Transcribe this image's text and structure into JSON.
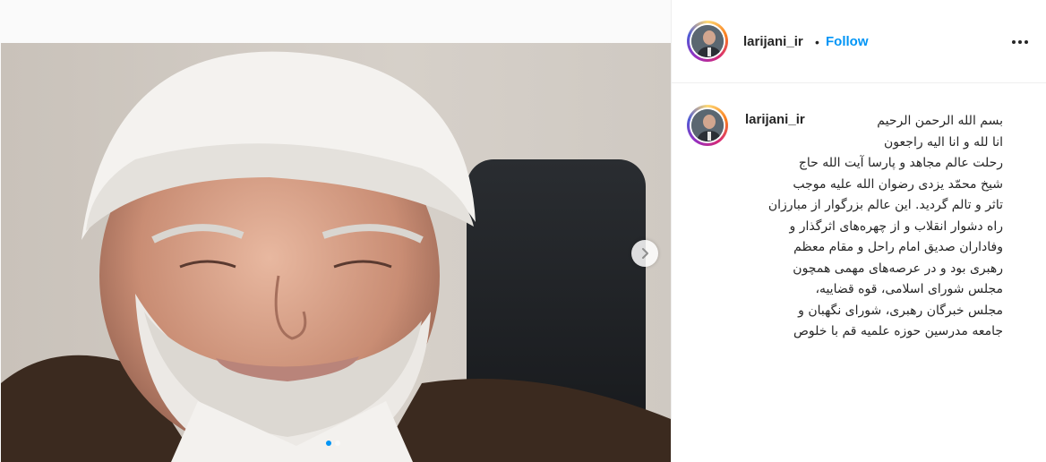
{
  "post": {
    "username": "larijani_ir",
    "separator": "•",
    "follow_label": "Follow",
    "more_icon": "more-horizontal-icon",
    "next_icon": "chevron-right-icon",
    "carousel": {
      "slides": 2,
      "active": 1
    },
    "caption": {
      "username": "larijani_ir",
      "lines": [
        "بسم الله الرحمن الرحیم",
        "انا لله و انا الیه راجعون",
        "رحلت عالم مجاهد و پارسا آیت الله حاج",
        "شیخ محمّد یزدی رضوان الله علیه موجب",
        "تاثر و تالم گردید. این عالم بزرگوار از مبارزان",
        "راه دشوار انقلاب و از چهره‌های اثرگذار و",
        "وفاداران صدیق امام راحل و مقام معظم",
        "رهبری بود و در عرصه‌های مهمی همچون",
        "مجلس شورای اسلامی، قوه قضاییه،",
        "مجلس خبرگان رهبری، شورای نگهبان و",
        "جامعه مدرسین حوزه علمیه قم با خلوص"
      ]
    },
    "colors": {
      "link": "#0095f6",
      "text": "#262626",
      "border": "#efefef"
    }
  }
}
